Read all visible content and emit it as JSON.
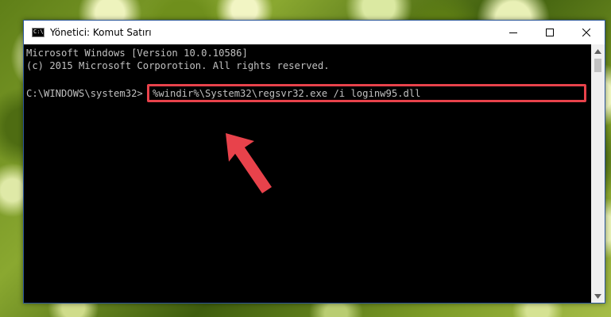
{
  "window": {
    "title": "Yönetici: Komut Satırı",
    "icon": "cmd-icon",
    "controls": {
      "minimize": "minimize-icon",
      "maximize": "maximize-icon",
      "close": "close-icon"
    }
  },
  "console": {
    "lines": [
      "Microsoft Windows [Version 10.0.10586]",
      "(c) 2015 Microsoft Corporotion. All rights reserved.",
      ""
    ],
    "prompt": "C:\\WINDOWS\\system32>",
    "command": "%windir%\\System32\\regsvr32.exe /i loginw95.dll"
  },
  "annotation": {
    "highlight_color": "#e8424b",
    "arrow_color": "#e8424b",
    "arrow": "arrow-up-left-icon"
  },
  "colors": {
    "console_bg": "#000000",
    "console_text": "#c0c0c0",
    "title_bg": "#ffffff",
    "window_border": "#2b579a"
  }
}
